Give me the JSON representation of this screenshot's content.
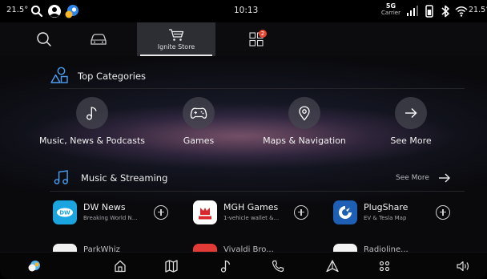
{
  "status_bar": {
    "temp_left": "21.5°",
    "time": "10:13",
    "network": "5G",
    "carrier": "Carrier",
    "temp_right": "21.5°"
  },
  "top_nav": {
    "tabs": [
      {
        "name": "search",
        "icon": "search-icon"
      },
      {
        "name": "vehicle",
        "icon": "car-icon"
      },
      {
        "name": "store",
        "icon": "cart-icon",
        "label": "Ignite Store",
        "active": true
      },
      {
        "name": "apps",
        "icon": "apps-grid-icon",
        "badge": "2"
      }
    ]
  },
  "top_categories": {
    "title": "Top Categories",
    "items": [
      {
        "label": "Music, News & Podcasts",
        "icon": "music-note-icon"
      },
      {
        "label": "Games",
        "icon": "gamepad-icon"
      },
      {
        "label": "Maps & Navigation",
        "icon": "map-pin-icon"
      },
      {
        "label": "See More",
        "icon": "arrow-right-icon"
      }
    ]
  },
  "music_streaming": {
    "title": "Music & Streaming",
    "see_more": "See More",
    "apps": [
      {
        "name": "DW News",
        "subtitle": "Breaking World N...",
        "icon_color": "#1aa5e0"
      },
      {
        "name": "MGH Games",
        "subtitle": "1-vehicle wallet &...",
        "icon_color": "#ffffff"
      },
      {
        "name": "PlugShare",
        "subtitle": "EV & Tesla Map",
        "icon_color": "#1d5fb5"
      }
    ],
    "partial_apps": [
      "ParkWhiz",
      "Vivaldi Bro...",
      "Radioline..."
    ]
  },
  "dock": {
    "items": [
      "home-icon",
      "map-icon",
      "music-icon",
      "phone-icon",
      "nav-arrow-icon",
      "apps-icon",
      "volume-icon"
    ]
  }
}
